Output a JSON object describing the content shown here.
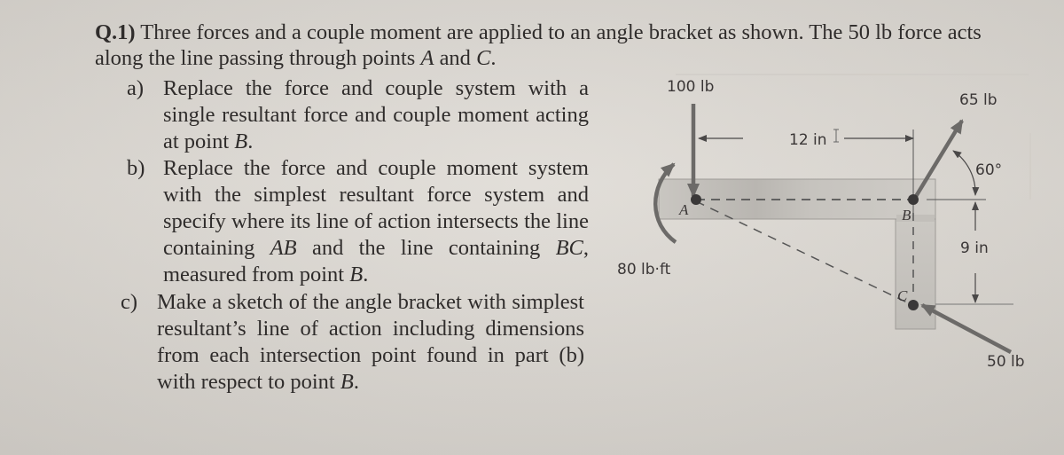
{
  "question": {
    "number": "Q.1)",
    "intro": " Three forces and a couple moment are applied to an angle bracket as shown. The 50 lb force acts along the line passing through points ",
    "point_a": "A",
    "and": " and ",
    "point_c": "C",
    "period": "."
  },
  "parts": {
    "a": {
      "label": "a)",
      "text_1": "Replace the force and couple system with a single resultant force and couple moment acting at point ",
      "point": "B",
      "text_2": "."
    },
    "b": {
      "label": "b)",
      "text_1": "Replace the force and couple moment system with the simplest resultant force system and specify where its line of action intersects the line containing ",
      "seg_ab": "AB",
      "text_2": " and the line containing ",
      "seg_bc": "BC",
      "text_3": ", measured from point ",
      "point": "B",
      "text_4": "."
    },
    "c": {
      "label": "c)",
      "text_1": "Make a sketch of the angle bracket with simplest resultant’s line of action including dimensions from each intersection point found in part (b) with respect to point ",
      "point": "B",
      "text_2": "."
    }
  },
  "figure": {
    "force_100": "100 lb",
    "force_65": "65 lb",
    "force_50": "50 lb",
    "couple": "80 lb·ft",
    "dim_horizontal": "12 in",
    "dim_vertical": "9 in",
    "angle": "60°",
    "point_a": "A",
    "point_b": "B",
    "point_c": "C"
  }
}
